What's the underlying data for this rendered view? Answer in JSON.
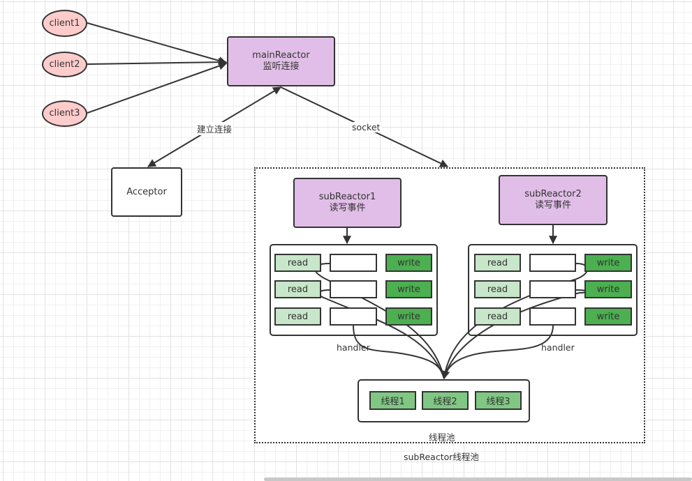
{
  "clients": [
    {
      "label": "client1"
    },
    {
      "label": "client2"
    },
    {
      "label": "client3"
    }
  ],
  "main_reactor": {
    "title": "mainReactor",
    "subtitle": "监听连接"
  },
  "acceptor": {
    "label": "Acceptor"
  },
  "edge_labels": {
    "establish_connection": "建立连接",
    "socket": "socket",
    "handler_left": "handler",
    "handler_right": "handler"
  },
  "sub_reactors": [
    {
      "title": "subReactor1",
      "subtitle": "读写事件",
      "rows": [
        {
          "read": "read",
          "write": "write"
        },
        {
          "read": "read",
          "write": "write"
        },
        {
          "read": "read",
          "write": "write"
        }
      ]
    },
    {
      "title": "subReactor2",
      "subtitle": "读写事件",
      "rows": [
        {
          "read": "read",
          "write": "write"
        },
        {
          "read": "read",
          "write": "write"
        },
        {
          "read": "read",
          "write": "write"
        }
      ]
    }
  ],
  "thread_pool": {
    "label": "线程池",
    "threads": [
      {
        "label": "线程1"
      },
      {
        "label": "线程2"
      },
      {
        "label": "线程3"
      }
    ]
  },
  "group_label": "subReactor线程池",
  "colors": {
    "client_fill": "#ffcccc",
    "reactor_fill": "#e1bee7",
    "read_fill": "#c8e6c9",
    "write_fill": "#4caf50",
    "thread_fill": "#81c784",
    "stroke": "#333333"
  }
}
